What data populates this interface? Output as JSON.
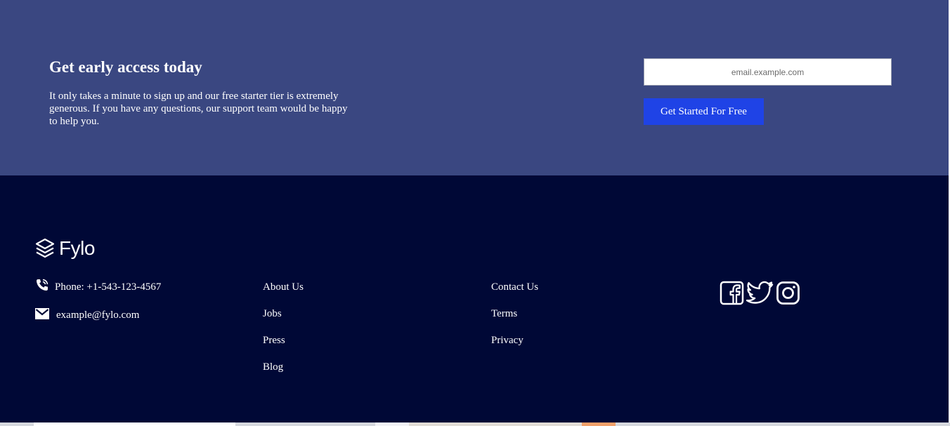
{
  "cta": {
    "title": "Get early access today",
    "description": "It only takes a minute to sign up and our free starter tier is extremely generous. If you have any questions, our support team would be happy to help you.",
    "email_placeholder": "email.example.com",
    "button_label": "Get Started For Free"
  },
  "footer": {
    "logo_text": "Fylo",
    "phone": "Phone: +1-543-123-4567",
    "email": "example@fylo.com",
    "links_col1": [
      "About Us",
      "Jobs",
      "Press",
      "Blog"
    ],
    "links_col2": [
      "Contact Us",
      "Terms",
      "Privacy"
    ],
    "social_icons": [
      "facebook-icon",
      "twitter-icon",
      "instagram-icon"
    ]
  },
  "colors": {
    "cta_background": "#3a4781",
    "footer_background": "#000836",
    "button_blue": "#1f43e6"
  }
}
